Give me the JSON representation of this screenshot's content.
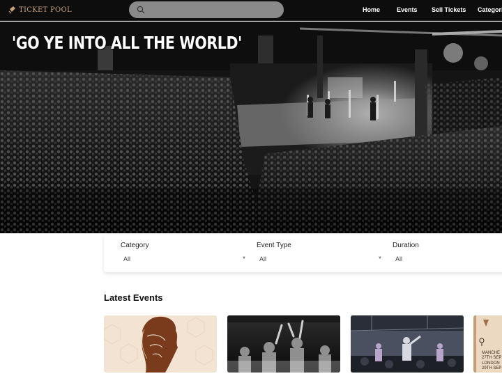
{
  "header": {
    "logo_text": "TICKET POOL",
    "search": {
      "placeholder": ""
    },
    "nav": [
      "Home",
      "Events",
      "Sell Tickets",
      "Categori"
    ]
  },
  "hero": {
    "title": "'GO YE INTO ALL THE WORLD'"
  },
  "filters": [
    {
      "label": "Category",
      "value": "All"
    },
    {
      "label": "Event Type",
      "value": "All"
    },
    {
      "label": "Duration",
      "value": "All"
    }
  ],
  "latest_events": {
    "title": "Latest Events",
    "cards": [
      {
        "image": "face-line-art"
      },
      {
        "image": "worship-crowd"
      },
      {
        "image": "stage-performance"
      },
      {
        "image": "tour-poster",
        "text": [
          "MANCHE",
          "27TH SEP",
          "LONDON",
          "29TH SEP"
        ]
      }
    ]
  },
  "colors": {
    "topbar": "#0d0d0d",
    "search": "#8a8a8a",
    "logo": "#c9a27a",
    "hero_overlay": "#111111"
  }
}
